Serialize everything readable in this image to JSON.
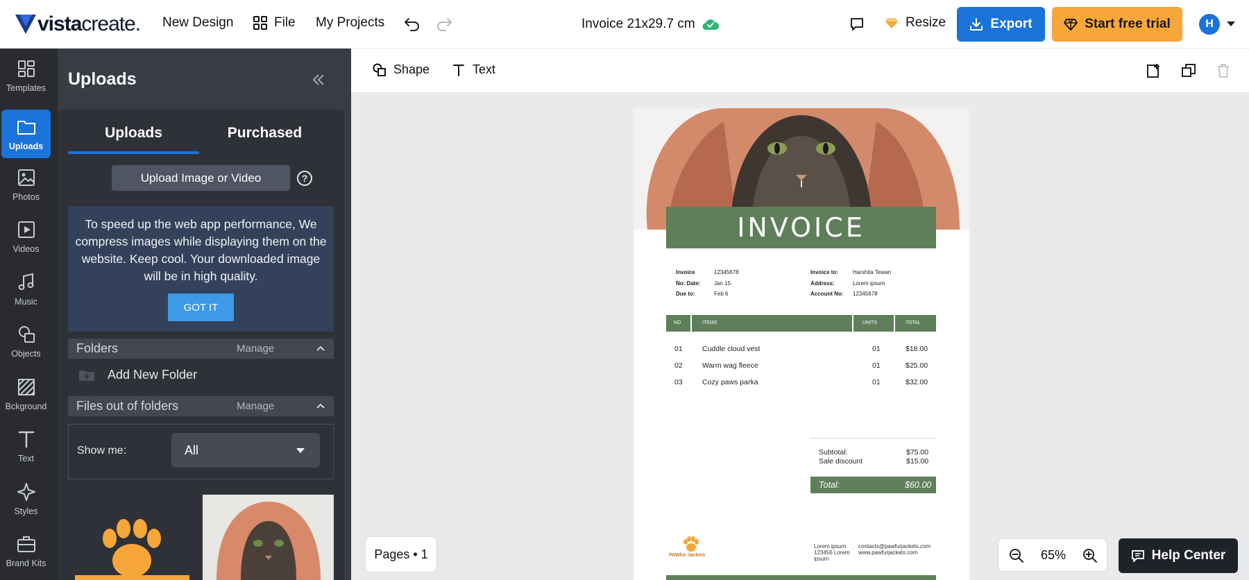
{
  "topbar": {
    "logo_bold": "vista",
    "logo_light": "create",
    "logo_suffix": ".",
    "new_design": "New Design",
    "file": "File",
    "my_projects": "My Projects",
    "doc_title": "Invoice 21x29.7 cm",
    "resize": "Resize",
    "export": "Export",
    "start_trial": "Start free trial",
    "avatar_initial": "H",
    "colors": {
      "export_bg": "#1a73d9",
      "trial_bg": "#f7a73a",
      "saved": "#2bb673"
    }
  },
  "rail": {
    "items": [
      {
        "label": "Templates",
        "icon": "templates-icon"
      },
      {
        "label": "Uploads",
        "icon": "folder-icon",
        "active": true
      },
      {
        "label": "Photos",
        "icon": "photo-icon"
      },
      {
        "label": "Videos",
        "icon": "video-icon"
      },
      {
        "label": "Music",
        "icon": "music-icon"
      },
      {
        "label": "Objects",
        "icon": "objects-icon"
      },
      {
        "label": "Bckground",
        "icon": "background-icon"
      },
      {
        "label": "Text",
        "icon": "text-icon"
      },
      {
        "label": "Styles",
        "icon": "styles-icon"
      },
      {
        "label": "Brand Kits",
        "icon": "brand-kit-icon"
      }
    ]
  },
  "panel": {
    "title": "Uploads",
    "tabs": [
      "Uploads",
      "Purchased"
    ],
    "upload_button": "Upload Image or Video",
    "help": "?",
    "notice": "To speed up the web app performance, We compress images while displaying them on the website. Keep cool. Your downloaded image will be in high quality.",
    "got_it": "GOT IT",
    "folders": {
      "label": "Folders",
      "manage": "Manage",
      "add": "Add New Folder"
    },
    "files": {
      "label": "Files out of folders",
      "manage": "Manage"
    },
    "show_me": {
      "label": "Show me:",
      "value": "All"
    }
  },
  "ctxbar": {
    "shape": "Shape",
    "text": "Text"
  },
  "invoice": {
    "title": "INVOICE",
    "meta_left": [
      {
        "k": "Invoice",
        "v": "12345678"
      },
      {
        "k": "No: Date:",
        "v": "Jan 15"
      },
      {
        "k": "Due to:",
        "v": "Feb 6"
      }
    ],
    "meta_right": [
      {
        "k": "Invoice to:",
        "v": "Harshita Tewari"
      },
      {
        "k": "Address:",
        "v": "Lorem ipsum"
      },
      {
        "k": "Account No:",
        "v": "12345678"
      }
    ],
    "columns": [
      "NO",
      "ITEMS",
      "UNITS",
      "TOTAL"
    ],
    "rows": [
      {
        "no": "01",
        "item": "Cuddle cloud vest",
        "units": "01",
        "total": "$18.00"
      },
      {
        "no": "02",
        "item": "Warm wag fleece",
        "units": "01",
        "total": "$25.00"
      },
      {
        "no": "03",
        "item": "Cozy paws parka",
        "units": "01",
        "total": "$32.00"
      }
    ],
    "subtotal_label": "Subtotal:",
    "subtotal": "$75.00",
    "discount_label": "Sale discount",
    "discount": "$15.00",
    "total_label": "Total:",
    "total": "$60.00",
    "brand": "PAWfur Jackets",
    "address": "Lorem ipsum 123456 Lorem ipsum",
    "email": "contacts@pawfurjackets.com",
    "website": "www.pawfurjackets.com",
    "accent": "#5e7f5a"
  },
  "footer": {
    "pages": "Pages • 1",
    "zoom": "65%",
    "help_center": "Help Center"
  }
}
